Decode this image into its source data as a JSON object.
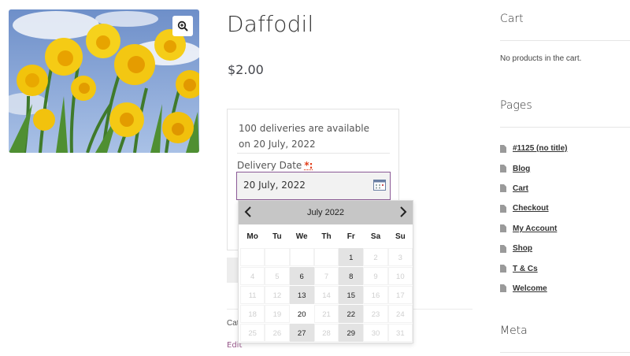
{
  "product": {
    "title": "Daffodil",
    "price": "$2.00",
    "availability_text": "100 deliveries are available on 20 July, 2022",
    "delivery_date_label": "Delivery Date",
    "required_marker": "*:",
    "delivery_date_value": "20 July, 2022",
    "edit_label": "Edit",
    "category_stub": "Cat"
  },
  "datepicker": {
    "title": "July 2022",
    "weekdays": [
      "Mo",
      "Tu",
      "We",
      "Th",
      "Fr",
      "Sa",
      "Su"
    ],
    "weeks": [
      [
        {
          "d": "",
          "s": "blank"
        },
        {
          "d": "",
          "s": "blank"
        },
        {
          "d": "",
          "s": "blank"
        },
        {
          "d": "",
          "s": "blank"
        },
        {
          "d": "1",
          "s": "avail"
        },
        {
          "d": "2",
          "s": "disabled"
        },
        {
          "d": "3",
          "s": "disabled"
        }
      ],
      [
        {
          "d": "4",
          "s": "disabled"
        },
        {
          "d": "5",
          "s": "disabled"
        },
        {
          "d": "6",
          "s": "avail"
        },
        {
          "d": "7",
          "s": "disabled"
        },
        {
          "d": "8",
          "s": "avail"
        },
        {
          "d": "9",
          "s": "disabled"
        },
        {
          "d": "10",
          "s": "disabled"
        }
      ],
      [
        {
          "d": "11",
          "s": "disabled"
        },
        {
          "d": "12",
          "s": "disabled"
        },
        {
          "d": "13",
          "s": "avail"
        },
        {
          "d": "14",
          "s": "disabled"
        },
        {
          "d": "15",
          "s": "avail"
        },
        {
          "d": "16",
          "s": "disabled"
        },
        {
          "d": "17",
          "s": "disabled"
        }
      ],
      [
        {
          "d": "18",
          "s": "disabled"
        },
        {
          "d": "19",
          "s": "disabled"
        },
        {
          "d": "20",
          "s": "selected"
        },
        {
          "d": "21",
          "s": "disabled"
        },
        {
          "d": "22",
          "s": "avail"
        },
        {
          "d": "23",
          "s": "disabled"
        },
        {
          "d": "24",
          "s": "disabled"
        }
      ],
      [
        {
          "d": "25",
          "s": "disabled"
        },
        {
          "d": "26",
          "s": "disabled"
        },
        {
          "d": "27",
          "s": "avail"
        },
        {
          "d": "28",
          "s": "disabled"
        },
        {
          "d": "29",
          "s": "avail"
        },
        {
          "d": "30",
          "s": "disabled"
        },
        {
          "d": "31",
          "s": "disabled"
        }
      ]
    ]
  },
  "sidebar": {
    "cart_title": "Cart",
    "cart_empty": "No products in the cart.",
    "pages_title": "Pages",
    "pages": [
      "#1125 (no title)",
      "Blog",
      "Cart",
      "Checkout",
      "My Account",
      "Shop",
      "T & Cs",
      "Welcome"
    ],
    "meta_title": "Meta"
  },
  "colors": {
    "accent": "#96588a",
    "input_border": "#8b5a96",
    "required": "#e2401c",
    "datepicker_header": "#c6c6c6",
    "available_day": "#e3e3e3"
  },
  "icons": {
    "zoom": "zoom-in-icon",
    "calendar": "calendar-icon",
    "prev": "chevron-left-icon",
    "next": "chevron-right-icon",
    "page": "page-icon"
  }
}
